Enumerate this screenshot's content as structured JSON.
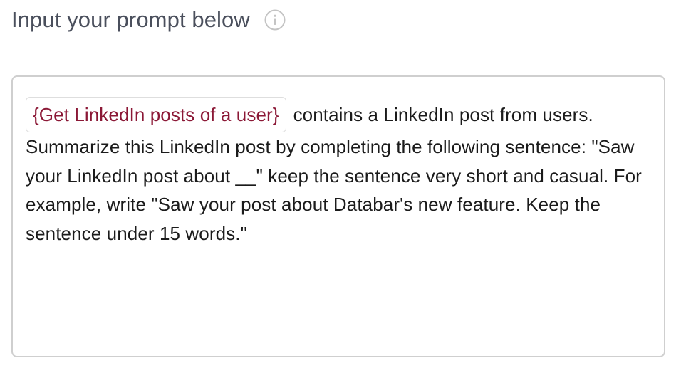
{
  "header": {
    "title": "Input your prompt below",
    "info_icon": "info-icon"
  },
  "prompt": {
    "variable_chip": "{Get LinkedIn posts of a user}",
    "text": "contains a LinkedIn post from users. Summarize this LinkedIn post by completing the following sentence: \"Saw your LinkedIn post about __\" keep the sentence very short and casual. For example, write \"Saw your post about Databar's new feature. Keep the sentence under 15 words.\""
  },
  "colors": {
    "title": "#4a4f5c",
    "chip_text": "#8b1836",
    "border": "#cfcfcf",
    "text": "#1b1b1b"
  }
}
